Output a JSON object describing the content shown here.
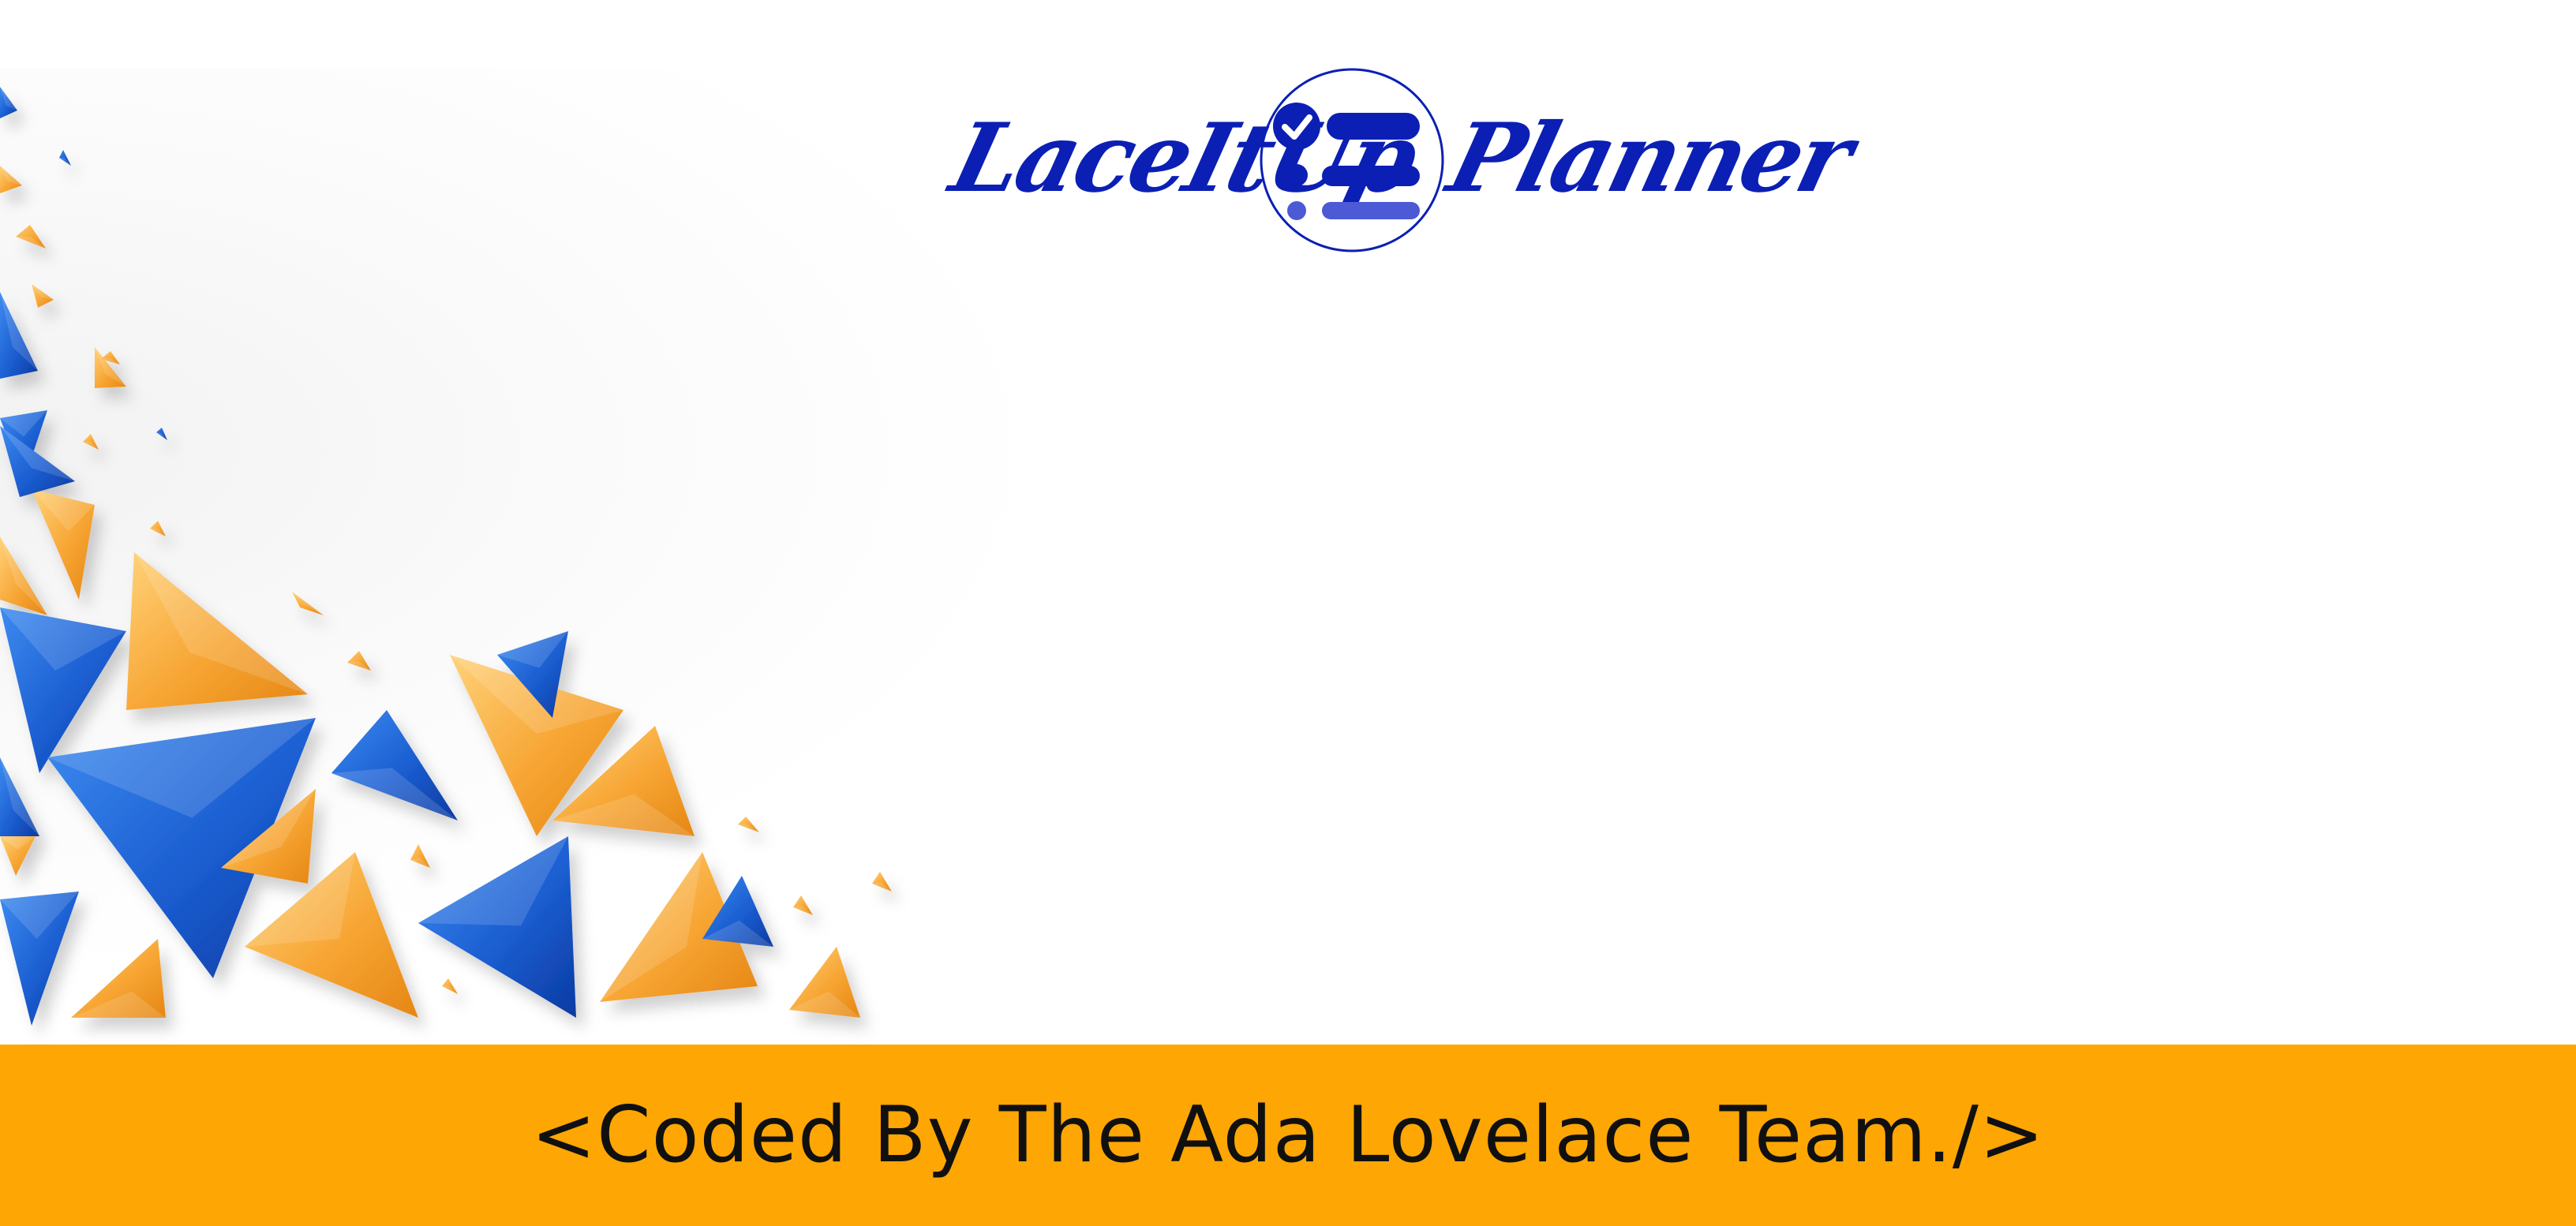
{
  "brand": {
    "name_left": "LaceItUp",
    "name_right": "Planner",
    "color": "#0b1fb4",
    "emblem_icon": "checklist-icon"
  },
  "footer": {
    "text": "<Coded By The Ada Lovelace Team./>",
    "background": "#fea603"
  },
  "decoration": {
    "icon": "triangles-pattern-icon",
    "colors": [
      "#1b5ed1",
      "#f7a533"
    ]
  }
}
